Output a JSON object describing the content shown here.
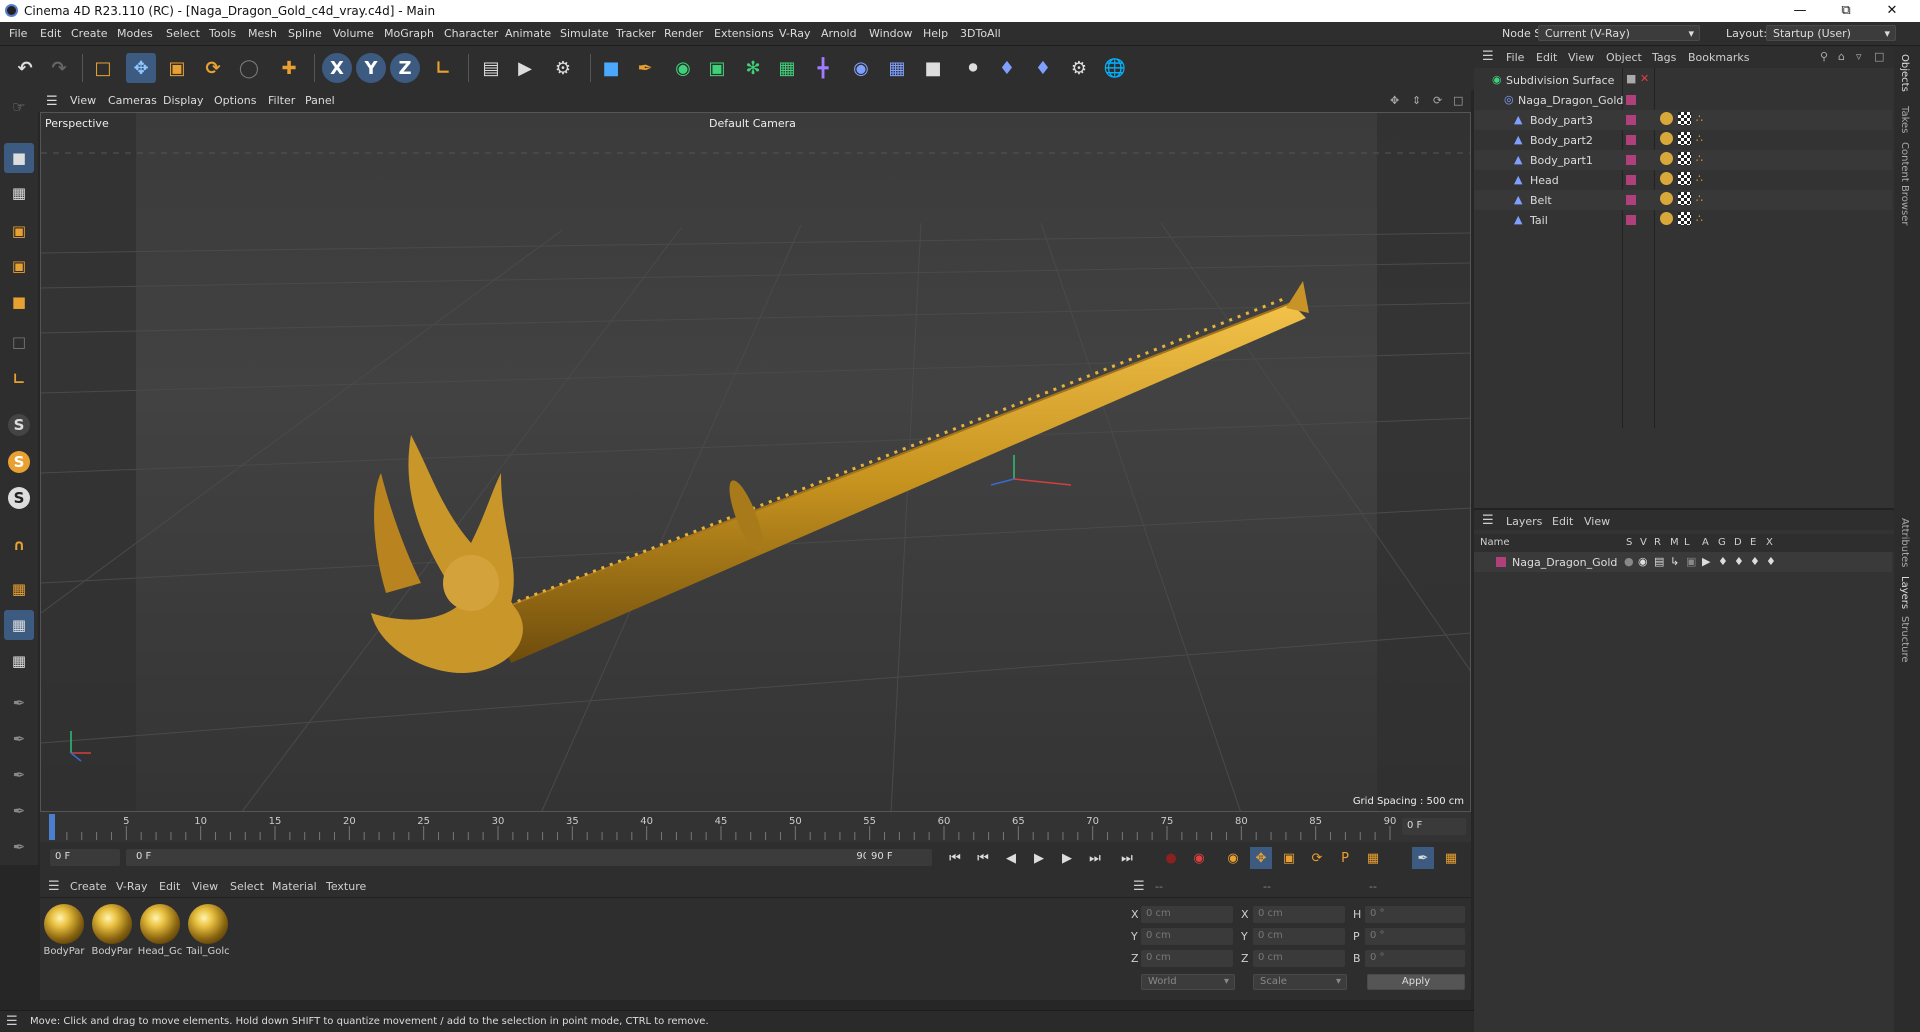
{
  "window": {
    "title": "Cinema 4D R23.110 (RC) - [Naga_Dragon_Gold_c4d_vray.c4d] - Main"
  },
  "menu": [
    "File",
    "Edit",
    "Create",
    "Modes",
    "Select",
    "Tools",
    "Mesh",
    "Spline",
    "Volume",
    "MoGraph",
    "Character",
    "Animate",
    "Simulate",
    "Tracker",
    "Render",
    "Extensions",
    "V-Ray",
    "Arnold",
    "Window",
    "Help",
    "3DToAll"
  ],
  "nodespace": {
    "label": "Node Space:",
    "value": "Current (V-Ray)"
  },
  "layout": {
    "label": "Layout:",
    "value": "Startup (User)"
  },
  "viewport_menu": [
    "View",
    "Cameras",
    "Display",
    "Options",
    "Filter",
    "Panel"
  ],
  "viewport": {
    "name": "Perspective",
    "camera": "Default Camera",
    "grid": "Grid Spacing : 500 cm"
  },
  "timeline": {
    "ticks": [
      "0",
      "5",
      "10",
      "15",
      "20",
      "25",
      "30",
      "35",
      "40",
      "45",
      "50",
      "55",
      "60",
      "65",
      "70",
      "75",
      "80",
      "85",
      "90"
    ],
    "current": "0 F"
  },
  "transport": {
    "start": "0 F",
    "range_start": "0 F",
    "range_end": "90 F",
    "end": "90 F"
  },
  "material_menu": [
    "Create",
    "V-Ray",
    "Edit",
    "View",
    "Select",
    "Material",
    "Texture"
  ],
  "materials": [
    "BodyPar",
    "BodyPar",
    "Head_Gc",
    "Tail_Golc"
  ],
  "coords": {
    "headers": [
      "--",
      "--",
      "--"
    ],
    "rows": [
      [
        "X",
        "0 cm",
        "X",
        "0 cm",
        "H",
        "0 °"
      ],
      [
        "Y",
        "0 cm",
        "Y",
        "0 cm",
        "P",
        "0 °"
      ],
      [
        "Z",
        "0 cm",
        "Z",
        "0 cm",
        "B",
        "0 °"
      ]
    ],
    "world": "World",
    "scale": "Scale",
    "apply": "Apply"
  },
  "status": "Move: Click and drag to move elements. Hold down SHIFT to quantize movement / add to the selection in point mode, CTRL to remove.",
  "objects_menu": [
    "File",
    "Edit",
    "View",
    "Object",
    "Tags",
    "Bookmarks"
  ],
  "objects": [
    "Subdivision Surface",
    "Naga_Dragon_Gold",
    "Body_part3",
    "Body_part2",
    "Body_part1",
    "Head",
    "Belt",
    "Tail"
  ],
  "layers_menu": [
    "Layers",
    "Edit",
    "View"
  ],
  "layers_header": {
    "name": "Name",
    "cols": [
      "S",
      "V",
      "R",
      "M",
      "L",
      "A",
      "G",
      "D",
      "E",
      "X"
    ]
  },
  "layers": [
    "Naga_Dragon_Gold"
  ],
  "vtabs": [
    "Objects",
    "Takes",
    "Content Browser",
    "Attributes",
    "Layers",
    "Structure"
  ]
}
